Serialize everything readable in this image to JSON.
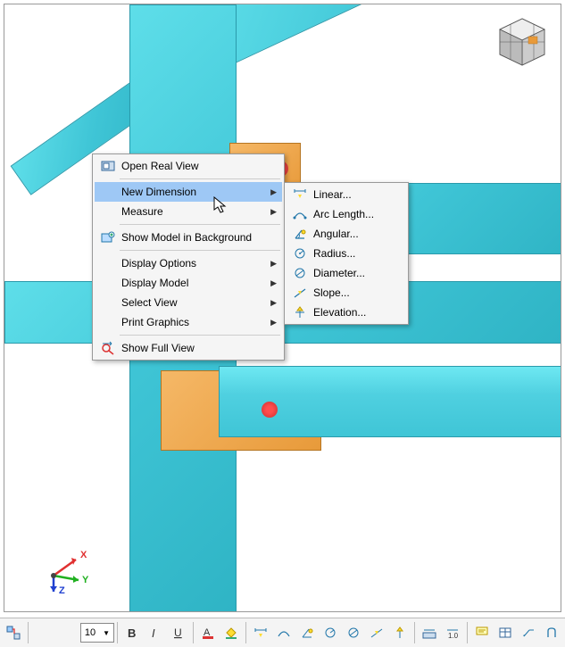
{
  "context_menu": {
    "open_real_view": "Open Real View",
    "new_dimension": "New Dimension",
    "measure": "Measure",
    "show_model_bg": "Show Model in Background",
    "display_options": "Display Options",
    "display_model": "Display Model",
    "select_view": "Select View",
    "print_graphics": "Print Graphics",
    "show_full_view": "Show Full View"
  },
  "dimension_submenu": {
    "linear": "Linear...",
    "arc_length": "Arc Length...",
    "angular": "Angular...",
    "radius": "Radius...",
    "diameter": "Diameter...",
    "slope": "Slope...",
    "elevation": "Elevation..."
  },
  "axes": {
    "x": "X",
    "y": "Y",
    "z": "Z"
  },
  "toolbar": {
    "font_size": "10"
  }
}
